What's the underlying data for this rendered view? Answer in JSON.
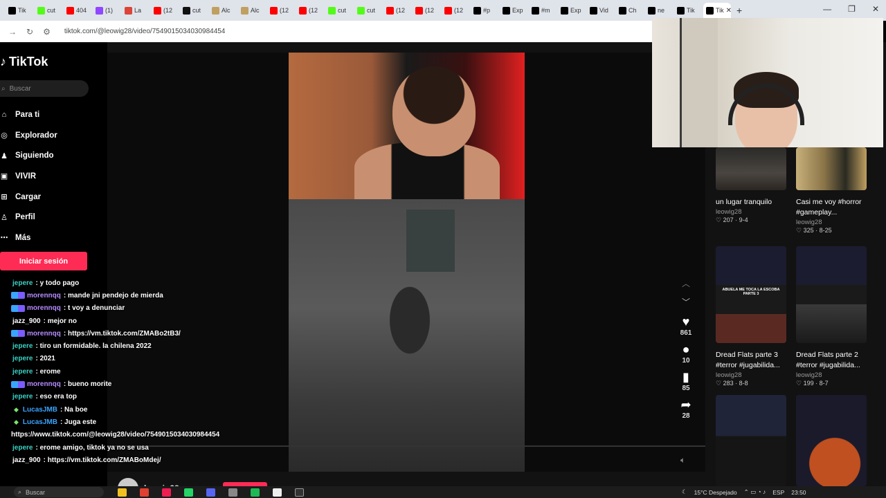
{
  "browser": {
    "tabs": [
      {
        "label": "Tik",
        "icon": "tiktok-icon",
        "color": "#000000"
      },
      {
        "label": "cut",
        "icon": "kick-icon",
        "color": "#53fc18"
      },
      {
        "label": "404",
        "icon": "youtube-icon",
        "color": "#ff0000"
      },
      {
        "label": "(1)",
        "icon": "twitch-icon",
        "color": "#9146ff"
      },
      {
        "label": "La",
        "icon": "chrome-icon",
        "color": "#db4437"
      },
      {
        "label": "(12",
        "icon": "youtube-icon",
        "color": "#ff0000"
      },
      {
        "label": "cut",
        "icon": "capcut-icon",
        "color": "#111111"
      },
      {
        "label": "Alc",
        "icon": "bookmark-icon",
        "color": "#c0a060"
      },
      {
        "label": "Alc",
        "icon": "bookmark-icon",
        "color": "#c0a060"
      },
      {
        "label": "(12",
        "icon": "youtube-icon",
        "color": "#ff0000"
      },
      {
        "label": "(12",
        "icon": "youtube-icon",
        "color": "#ff0000"
      },
      {
        "label": "cut",
        "icon": "kick-icon",
        "color": "#53fc18"
      },
      {
        "label": "cut",
        "icon": "kick-icon",
        "color": "#53fc18"
      },
      {
        "label": "(12",
        "icon": "youtube-icon",
        "color": "#ff0000"
      },
      {
        "label": "(12",
        "icon": "youtube-icon",
        "color": "#ff0000"
      },
      {
        "label": "(12",
        "icon": "youtube-icon",
        "color": "#ff0000"
      },
      {
        "label": "#p",
        "icon": "tiktok-icon",
        "color": "#000000"
      },
      {
        "label": "Exp",
        "icon": "tiktok-icon",
        "color": "#000000"
      },
      {
        "label": "#m",
        "icon": "tiktok-icon",
        "color": "#000000"
      },
      {
        "label": "Exp",
        "icon": "tiktok-icon",
        "color": "#000000"
      },
      {
        "label": "Vid",
        "icon": "tiktok-icon",
        "color": "#000000"
      },
      {
        "label": "Ch",
        "icon": "tiktok-icon",
        "color": "#000000"
      },
      {
        "label": "ne",
        "icon": "tiktok-icon",
        "color": "#000000"
      },
      {
        "label": "Tik",
        "icon": "tiktok-icon",
        "color": "#000000"
      },
      {
        "label": "Tik",
        "icon": "tiktok-icon",
        "color": "#000000"
      }
    ],
    "url": "tiktok.com/@leowig28/video/7549015034030984454"
  },
  "sidebar": {
    "logo": "TikTok",
    "search_placeholder": "Buscar",
    "items": [
      {
        "label": "Para ti",
        "icon": "home-icon"
      },
      {
        "label": "Explorador",
        "icon": "compass-icon"
      },
      {
        "label": "Siguiendo",
        "icon": "following-icon"
      },
      {
        "label": "VIVIR",
        "icon": "live-icon"
      },
      {
        "label": "Cargar",
        "icon": "upload-icon"
      },
      {
        "label": "Perfil",
        "icon": "profile-icon"
      },
      {
        "label": "Más",
        "icon": "more-icon"
      }
    ],
    "login_label": "Iniciar sesión"
  },
  "video": {
    "likes": "861",
    "comments": "10",
    "saves": "85",
    "shares": "28",
    "uploader": "leowig28"
  },
  "related": [
    {
      "title": "un lugar tranquilo",
      "user": "leowig28",
      "likes": "207",
      "date": "9-4"
    },
    {
      "title": "Casi me voy #horror #gameplay...",
      "user": "leowig28",
      "likes": "325",
      "date": "8-25"
    },
    {
      "title": "Dread Flats parte 3 #terror #jugabilida...",
      "user": "leowig28",
      "likes": "283",
      "date": "8-8",
      "thumb_caption": "ABUELA ME TOCA LA ESCOBA PARTE 3"
    },
    {
      "title": "Dread Flats parte 2 #terror #jugabilida...",
      "user": "leowig28",
      "likes": "199",
      "date": "8-7"
    }
  ],
  "chat": [
    {
      "user": "jepere",
      "msg": ": y todo pago",
      "color": "#39d1c4",
      "badge": false,
      "diamond": false
    },
    {
      "user": "morennqq",
      "msg": ": mande jni pendejo de mierda",
      "color": "#b58bff",
      "badge": true,
      "diamond": false
    },
    {
      "user": "morennqq",
      "msg": ": t voy a denunciar",
      "color": "#b58bff",
      "badge": true,
      "diamond": false
    },
    {
      "user": "jazz_900",
      "msg": ": mejor no",
      "color": "#ffffff",
      "badge": false,
      "diamond": false
    },
    {
      "user": "morennqq",
      "msg": ": https://vm.tiktok.com/ZMABo2tB3/",
      "color": "#b58bff",
      "badge": true,
      "diamond": false
    },
    {
      "user": "jepere",
      "msg": ": tiro un formidable. la chilena 2022",
      "color": "#39d1c4",
      "badge": false,
      "diamond": false
    },
    {
      "user": "jepere",
      "msg": ": 2021",
      "color": "#39d1c4",
      "badge": false,
      "diamond": false
    },
    {
      "user": "jepere",
      "msg": ": erome",
      "color": "#39d1c4",
      "badge": false,
      "diamond": false
    },
    {
      "user": "morennqq",
      "msg": ": bueno morite",
      "color": "#b58bff",
      "badge": true,
      "diamond": false
    },
    {
      "user": "jepere",
      "msg": ": eso era top",
      "color": "#39d1c4",
      "badge": false,
      "diamond": false
    },
    {
      "user": "LucasJMB",
      "msg": ": Na boe",
      "color": "#3aa3ff",
      "badge": false,
      "diamond": true
    },
    {
      "user": "LucasJMB",
      "msg": ": Juga este",
      "color": "#3aa3ff",
      "badge": false,
      "diamond": true
    },
    {
      "user": "",
      "msg": "https://www.tiktok.com/@leowig28/video/7549015034030984454",
      "color": "#ffffff",
      "badge": false,
      "diamond": false
    },
    {
      "user": "jepere",
      "msg": ": erome amigo, tiktok ya no se usa",
      "color": "#39d1c4",
      "badge": false,
      "diamond": false
    },
    {
      "user": "jazz_900",
      "msg": ": https://vm.tiktok.com/ZMABoMdej/",
      "color": "#ffffff",
      "badge": false,
      "diamond": false
    }
  ],
  "taskbar": {
    "search_placeholder": "Buscar",
    "weather": "15°C  Despejado",
    "lang": "ESP",
    "time": "23:50"
  },
  "colors": {
    "accent": "#fe2c55",
    "page_bg": "#121212"
  }
}
